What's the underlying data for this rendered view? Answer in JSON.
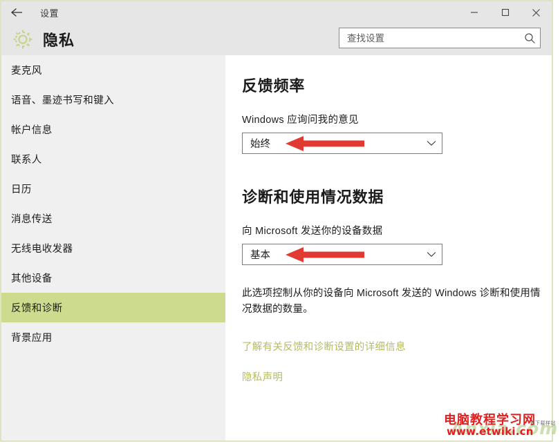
{
  "window": {
    "titlebar_title": "设置",
    "back_icon": "back-arrow-icon",
    "minimize_icon": "minimize-icon",
    "maximize_icon": "maximize-icon",
    "close_icon": "close-icon",
    "frame_border_color": "#dfe2c4",
    "titlebar_bg": "#e6e6e6"
  },
  "header": {
    "gear_icon": "gear-icon",
    "page_title": "隐私",
    "accent_color": "#cddb8f"
  },
  "search": {
    "placeholder": "查找设置",
    "value": "",
    "icon": "search-icon"
  },
  "sidebar": {
    "background": "#f0f0f0",
    "selected_index": 8,
    "selected_bg": "#cddb8f",
    "items": [
      {
        "label": "麦克风",
        "selected": false
      },
      {
        "label": "语音、墨迹书写和键入",
        "selected": false
      },
      {
        "label": "帐户信息",
        "selected": false
      },
      {
        "label": "联系人",
        "selected": false
      },
      {
        "label": "日历",
        "selected": false
      },
      {
        "label": "消息传送",
        "selected": false
      },
      {
        "label": "无线电收发器",
        "selected": false
      },
      {
        "label": "其他设备",
        "selected": false
      },
      {
        "label": "反馈和诊断",
        "selected": true
      },
      {
        "label": "背景应用",
        "selected": false
      }
    ]
  },
  "main": {
    "section1": {
      "title": "反馈频率",
      "field_label": "Windows 应询问我的意见",
      "dropdown_value": "始终",
      "chevron_icon": "chevron-down-icon",
      "annotation_icon": "red-arrow-annotation"
    },
    "section2": {
      "title": "诊断和使用情况数据",
      "field_label": "向 Microsoft 发送你的设备数据",
      "dropdown_value": "基本",
      "chevron_icon": "chevron-down-icon",
      "annotation_icon": "red-arrow-annotation"
    },
    "description": "此选项控制从你的设备向 Microsoft 发送的 Windows 诊断和使用情况数据的数量。",
    "links": [
      {
        "label": "了解有关反馈和诊断设置的详细信息"
      },
      {
        "label": "隐私声明"
      }
    ],
    "link_color": "#b5bd5e"
  },
  "watermark": {
    "line1": "电脑教程学习网",
    "line2": "www.etwiki.cn",
    "ghost": "Anxia.com",
    "small": "安下载样站",
    "color_red": "#e02020",
    "color_ghost": "#9fbe6a"
  }
}
